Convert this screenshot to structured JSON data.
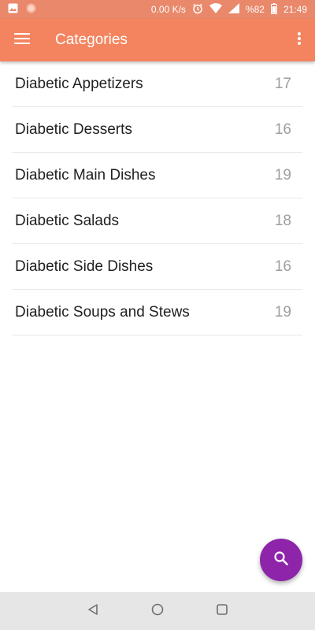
{
  "status_bar": {
    "network_speed": "0.00 K/s",
    "battery": "%82",
    "time": "21:49",
    "left_icons": [
      "image-icon",
      "notification-dot-icon"
    ],
    "right_icons": [
      "alarm-icon",
      "wifi-icon",
      "signal-icon",
      "battery-icon"
    ]
  },
  "app_bar": {
    "title": "Categories",
    "color": "#f4845f"
  },
  "categories": [
    {
      "label": "Diabetic Appetizers",
      "count": "17"
    },
    {
      "label": "Diabetic Desserts",
      "count": "16"
    },
    {
      "label": "Diabetic Main Dishes",
      "count": "19"
    },
    {
      "label": "Diabetic Salads",
      "count": "18"
    },
    {
      "label": "Diabetic Side Dishes",
      "count": "16"
    },
    {
      "label": "Diabetic Soups and Stews",
      "count": "19"
    }
  ],
  "fab": {
    "icon": "search-icon",
    "color": "#8e24aa"
  },
  "nav_bar": {
    "icons": [
      "back-icon",
      "home-icon",
      "recents-icon"
    ]
  }
}
